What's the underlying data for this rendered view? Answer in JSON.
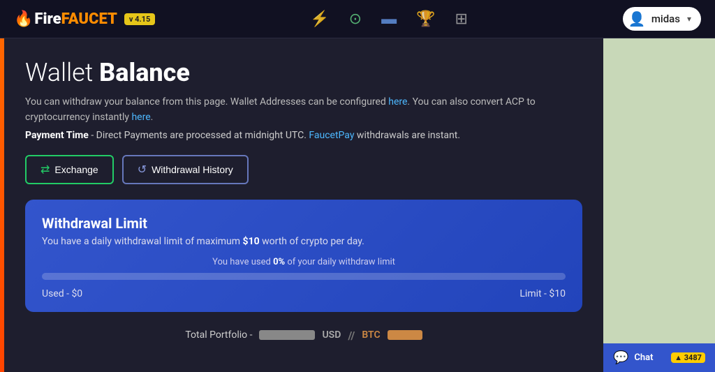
{
  "header": {
    "logo": {
      "fire_part": "Fire",
      "faucet_part": "FAUCET",
      "version": "v 4.15"
    },
    "icons": {
      "lightning": "⚡",
      "coins": "⟳",
      "card": "💳",
      "trophy": "🏆",
      "grid": "▦"
    },
    "user": {
      "name": "midas",
      "chevron": "▾"
    }
  },
  "page": {
    "title_light": "Wallet",
    "title_bold": "Balance",
    "description_1": "You can withdraw your balance from this page. Wallet Addresses can be configured ",
    "link_here_1": "here",
    "description_2": ". You can also convert ACP to cryptocurrency instantly ",
    "link_here_2": "here",
    "description_3": ".",
    "payment_label": "Payment Time",
    "payment_text": " - Direct Payments are processed at midnight UTC. ",
    "payment_link": "FaucetPay",
    "payment_text2": " withdrawals are instant."
  },
  "buttons": {
    "exchange": "Exchange",
    "withdrawal_history": "Withdrawal History"
  },
  "withdrawal_card": {
    "title": "Withdrawal Limit",
    "subtitle_1": "You have a daily withdrawal limit of maximum ",
    "limit_amount": "$10",
    "subtitle_2": " worth of crypto per day.",
    "usage_text_1": "You have used ",
    "usage_pct": "0%",
    "usage_text_2": " of your daily withdraw limit",
    "progress_pct": 0,
    "used_label": "Used - $0",
    "limit_label": "Limit - $10"
  },
  "portfolio": {
    "label": "Total Portfolio -",
    "usd": "USD",
    "separator": "//",
    "btc": "BTC"
  },
  "chat": {
    "label": "Chat",
    "badge": "▲ 3487"
  }
}
